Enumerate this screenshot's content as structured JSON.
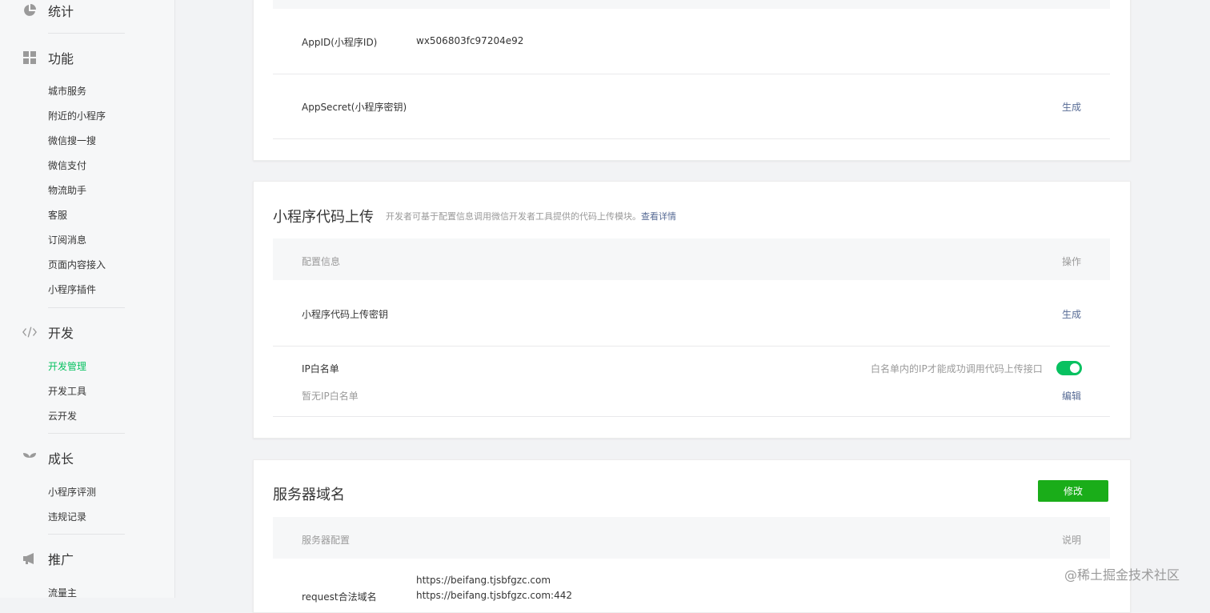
{
  "sidebar": {
    "groups": [
      {
        "title": "统计",
        "icon": "pie-chart-icon"
      },
      {
        "title": "功能",
        "icon": "grid-icon",
        "items": [
          "城市服务",
          "附近的小程序",
          "微信搜一搜",
          "微信支付",
          "物流助手",
          "客服",
          "订阅消息",
          "页面内容接入",
          "小程序插件"
        ]
      },
      {
        "title": "开发",
        "icon": "code-icon",
        "items": [
          "开发管理",
          "开发工具",
          "云开发"
        ],
        "active": "开发管理"
      },
      {
        "title": "成长",
        "icon": "sprout-icon",
        "items": [
          "小程序评测",
          "违规记录"
        ]
      },
      {
        "title": "推广",
        "icon": "megaphone-icon",
        "items": [
          "流量主"
        ]
      }
    ]
  },
  "appinfo": {
    "appid_label": "AppID(小程序ID)",
    "appid_value": "wx506803fc97204e92",
    "secret_label": "AppSecret(小程序密钥)",
    "secret_action": "生成"
  },
  "upload": {
    "title": "小程序代码上传",
    "desc": "开发者可基于配置信息调用微信开发者工具提供的代码上传模块。",
    "desc_link": "查看详情",
    "col_config": "配置信息",
    "col_action": "操作",
    "key_label": "小程序代码上传密钥",
    "key_action": "生成",
    "ip_label": "IP白名单",
    "ip_hint": "白名单内的IP才能成功调用代码上传接口",
    "ip_toggle_on": true,
    "ip_empty": "暂无IP白名单",
    "ip_edit": "编辑"
  },
  "server": {
    "title": "服务器域名",
    "modify_button": "修改",
    "col_config": "服务器配置",
    "col_desc": "说明",
    "request_label": "request合法域名",
    "request_domains": [
      "https://beifang.tjsbfgzc.com",
      "https://beifang.tjsbfgzc.com:442"
    ]
  },
  "watermark": "@稀土掘金技术社区"
}
